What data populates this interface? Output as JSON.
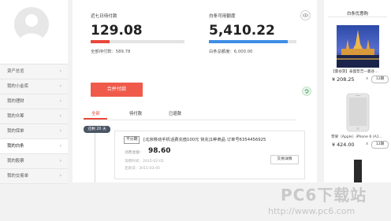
{
  "sidebar": {
    "items": [
      {
        "label": "资产总览"
      },
      {
        "label": "我的小金库"
      },
      {
        "label": "我的理财"
      },
      {
        "label": "我的众筹"
      },
      {
        "label": "我的保单"
      },
      {
        "label": "我的白条"
      },
      {
        "label": "我的股票"
      },
      {
        "label": "我的交易单"
      }
    ],
    "chevron": "›"
  },
  "stats": {
    "week_pay": {
      "label": "近七日待付款",
      "value": "129.08",
      "sub_label": "全部待付款：",
      "sub_value": "589.78",
      "progress": 0.2
    },
    "available": {
      "label": "白条可用额度",
      "value": "5,410.22",
      "sub_label": "白条总额度：",
      "sub_value": "6,000.00",
      "progress": 0.9
    }
  },
  "pay_button": "合并付款",
  "tabs": [
    {
      "label": "全部",
      "active": true
    },
    {
      "label": "待付款",
      "active": false
    },
    {
      "label": "已退款",
      "active": false
    }
  ],
  "timeline_badge": "还剩 20 天",
  "order": {
    "tag": "不分期",
    "title": "[北京移动手机话费充值100元 快充]1种商品 订单号6354456925",
    "amount_label": "消费金额：",
    "amount": "98.60",
    "date1": "消费时间：2015-02-05",
    "date2": "还款日：2015-03-05",
    "detail_button": "交易详情"
  },
  "right": {
    "title": "白条优惠购",
    "products": [
      {
        "name": "【曼谷游】泰国普吉一曼谷...",
        "price": "¥ 208.25",
        "x": "x",
        "periods": "12期"
      },
      {
        "name": "苹果（Apple）iPhone 6 (A1...",
        "price": "¥ 424.00",
        "x": "x",
        "periods": "12期"
      }
    ]
  },
  "watermark": {
    "logo": "PC6下载站",
    "url": "http://www.pc6.com"
  },
  "colors": {
    "accent": "#e84b3b",
    "bar_red": "#e8473b",
    "bar_blue": "#3d8ee6"
  }
}
